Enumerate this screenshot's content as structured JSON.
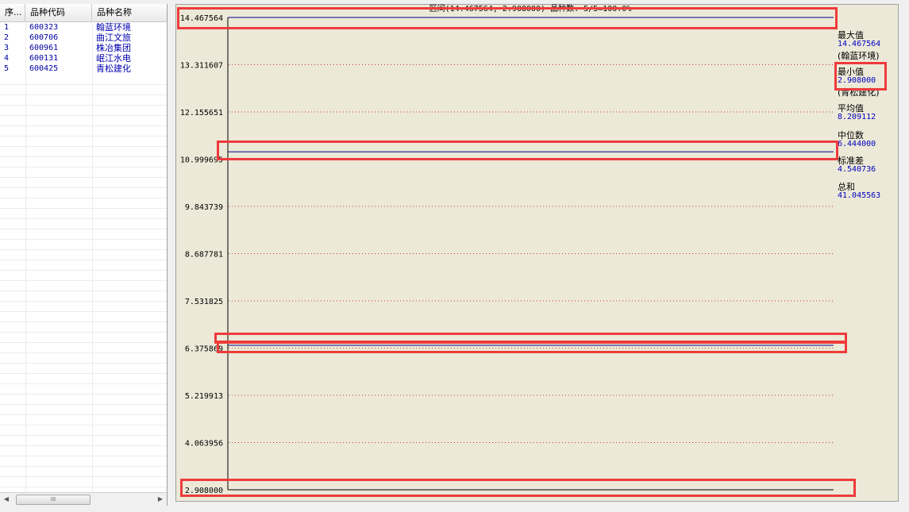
{
  "table": {
    "headers": [
      "序...",
      "品种代码",
      "品种名称"
    ],
    "rows": [
      {
        "index": "1",
        "code": "600323",
        "name": "翰蓝环境"
      },
      {
        "index": "2",
        "code": "600706",
        "name": "曲江文旅"
      },
      {
        "index": "3",
        "code": "600961",
        "name": "株冶集团"
      },
      {
        "index": "4",
        "code": "600131",
        "name": "岷江水电"
      },
      {
        "index": "5",
        "code": "600425",
        "name": "青松建化"
      }
    ],
    "scroll_thumb_label": "III"
  },
  "chart_title": "区间(14.467564, 2.908000) 品种数: 5/5=100.0%",
  "stats": {
    "max_label": "最大值",
    "max_value": "14.467564",
    "max_name": "(翰蓝环境)",
    "min_label": "最小值",
    "min_value": "2.908000",
    "min_name": "(青松建化)",
    "mean_label": "平均值",
    "mean_value": "8.209112",
    "median_label": "中位数",
    "median_value": "6.444000",
    "std_label": "标准差",
    "std_value": "4.540736",
    "sum_label": "总和",
    "sum_value": "41.045563"
  },
  "chart_data": {
    "type": "line",
    "title": "区间(14.467564, 2.908000) 品种数: 5/5=100.0%",
    "ylim": [
      2.908,
      14.467564
    ],
    "y_ticks": [
      "14.467564",
      "13.311607",
      "12.155651",
      "10.999695",
      "9.843739",
      "8.687781",
      "7.531825",
      "6.375869",
      "5.219913",
      "4.063956",
      "2.908000"
    ],
    "series": [
      {
        "name": "翰蓝环境",
        "value": 14.467564
      },
      {
        "name": "曲江文旅",
        "value": 11.18
      },
      {
        "name": "株冶集团",
        "value": 6.53
      },
      {
        "name": "岷江水电",
        "value": 6.444
      },
      {
        "name": "青松建化",
        "value": 2.908
      }
    ],
    "grid": true,
    "colors": {
      "value_line": "#00008b",
      "grid": "#cc3333",
      "axis": "#000000"
    }
  }
}
